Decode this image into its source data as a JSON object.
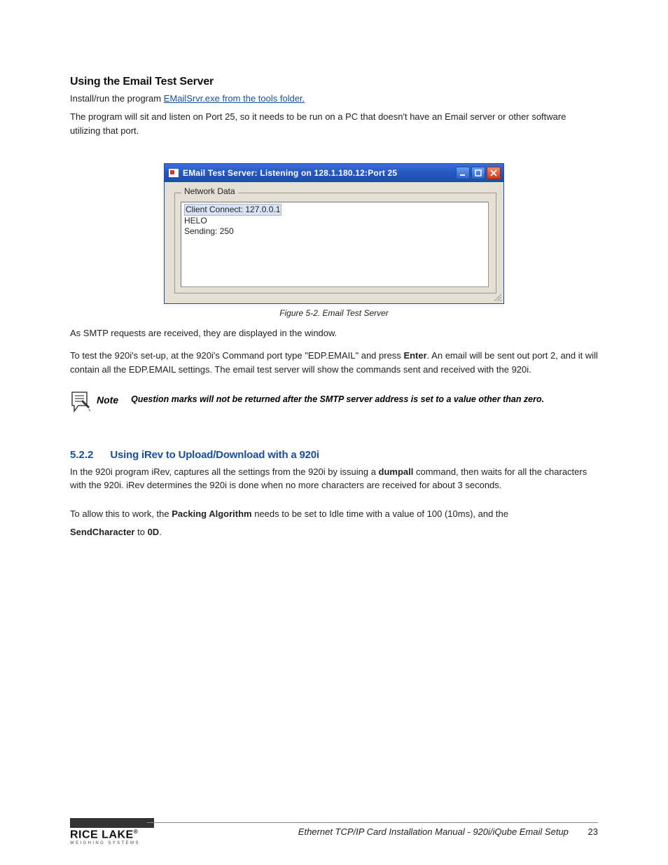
{
  "heading1": "Using the Email Test Server",
  "intro": {
    "p1_pre": "Install/run the program ",
    "p1_link": "EMailSrvr.exe from the tools folder.",
    "p2": "The program will sit and listen on Port 25, so it needs to be run on a PC that doesn't have an Email server or other software utilizing that port."
  },
  "window": {
    "title": "EMail Test Server: Listening on 128.1.180.12:Port 25",
    "group_label": "Network Data",
    "log": {
      "l1": "Client Connect: 127.0.0.1",
      "l2": "HELO",
      "l3": "Sending: 250"
    }
  },
  "fig_caption": "Figure 5-2. Email Test Server",
  "after_fig": {
    "p1": "As SMTP requests are received, they are displayed in the window.",
    "p2_a": "To test the 920i's set-up, at the 920i's Command port type \"EDP.EMAIL\" and press ",
    "p2_enter": "Enter",
    "p2_b": ". An email will be sent out port 2, and it will contain all the EDP.EMAIL settings. The email test server will show the commands sent and received with the 920i."
  },
  "note": {
    "label": "Note",
    "text": "Question marks will not be returned after the SMTP server address is set to a value other than zero."
  },
  "subsection": {
    "num": "5.2.2",
    "title": "Using iRev to Upload/Download with a 920i",
    "p1_a": "In the 920i program iRev, captures all the settings from the 920i by issuing a ",
    "p1_i": "dumpall",
    "p1_b": " command, then waits for all the characters with the 920i. iRev determines the 920i is done when no more characters are received for about 3 seconds.",
    "p2_a": "To allow this to work, the ",
    "p2_i1": "Packing Algorithm",
    "p2_mid": " needs to be set to Idle time with a value of 100 (10ms), and the ",
    "p2_i2": "SendCharacter",
    "p2_b": " to ",
    "p2_i3": "0D",
    "p2_c": "."
  },
  "footer": {
    "brand_line1": "RICE LAKE",
    "brand_line2": "WEIGHING SYSTEMS",
    "doc": "Ethernet TCP/IP Card Installation Manual - 920i/iQube Email Setup",
    "page": "23"
  }
}
